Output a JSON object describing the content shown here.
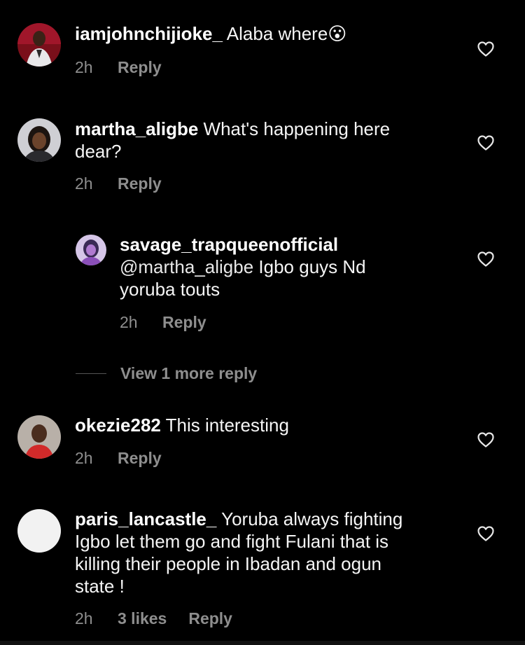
{
  "comments": [
    {
      "username": "iamjohnchijioke_",
      "text": "Alaba where",
      "emoji": "😮",
      "time": "2h",
      "reply_label": "Reply"
    },
    {
      "username": "martha_aligbe",
      "text_line1": "What's happening here",
      "text_line2": "dear?",
      "time": "2h",
      "reply_label": "Reply"
    },
    {
      "username": "savage_trapqueenofficial",
      "mention": "@martha_aligbe",
      "text_line1": "Igbo guys Nd",
      "text_line2": "yoruba touts",
      "time": "2h",
      "reply_label": "Reply"
    },
    {
      "username": "okezie282",
      "text": "This interesting",
      "time": "2h",
      "reply_label": "Reply"
    },
    {
      "username": "paris_lancastle_",
      "text_line1": "Yoruba always fighting",
      "text_line2": "Igbo let them go and fight Fulani that is",
      "text_line3": "killing their people in Ibadan and ogun",
      "text_line4": "state !",
      "time": "2h",
      "likes": "3 likes",
      "reply_label": "Reply"
    }
  ],
  "view_more_replies": "View 1 more reply",
  "icons": {
    "like": "heart-outline-icon"
  },
  "colors": {
    "background": "#000000",
    "secondary_text": "#8e8e8e"
  }
}
